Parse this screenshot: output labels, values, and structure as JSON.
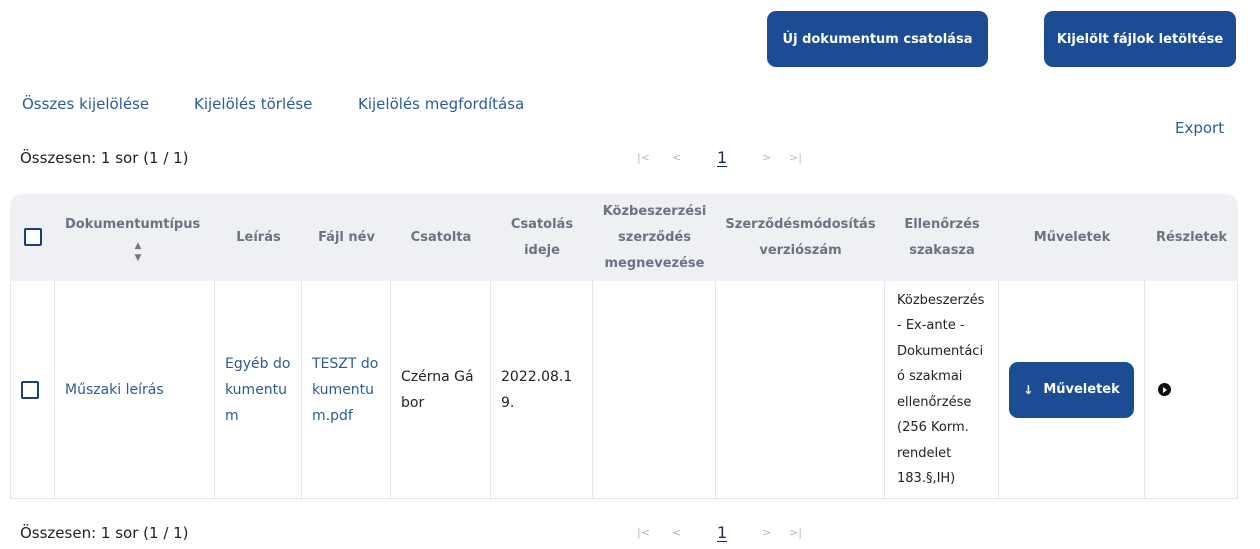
{
  "toolbar": {
    "attach_label": "Új dokumentum csatolása",
    "download_label": "Kijelölt fájlok letöltése"
  },
  "selection": {
    "select_all": "Összes kijelölése",
    "clear": "Kijelölés törlése",
    "invert": "Kijelölés megfordítása"
  },
  "export_label": "Export",
  "summary": "Összesen: 1 sor (1 / 1)",
  "pager": {
    "first": "|<",
    "prev": "<",
    "current": "1",
    "next": ">",
    "last": ">|"
  },
  "table": {
    "headers": {
      "doc_type": "Dokumentumtípus",
      "description": "Leírás",
      "file_name": "Fájl név",
      "attached_by": "Csatolta",
      "attached_at": "Csatolás ideje",
      "contract_name": "Közbeszerzési szerződés megnevezése",
      "amendment_version": "Szerződésmódosítás verziószám",
      "review_phase": "Ellenőrzés szakasza",
      "actions": "Műveletek",
      "details": "Részletek"
    },
    "rows": [
      {
        "doc_type": "Műszaki leírás",
        "description": "Egyéb dokumentum",
        "file_name": "TESZT dokumentum.pdf",
        "attached_by": "Czérna Gábor",
        "attached_at": "2022.08.19.",
        "contract_name": "",
        "amendment_version": "",
        "review_phase": "Közbeszerzés - Ex-ante - Dokumentáció szakmai ellenőrzése (256 Korm. rendelet 183.§,IH)",
        "actions_label": "Műveletek"
      }
    ]
  },
  "icons": {
    "sort": "sort-icon",
    "arrow": "arrow-down-icon",
    "details": "play-circle-icon"
  },
  "colors": {
    "primary": "#1c4d94",
    "link": "#2d5b97",
    "header_bg": "#eef0f4",
    "header_text": "#6b7281"
  }
}
